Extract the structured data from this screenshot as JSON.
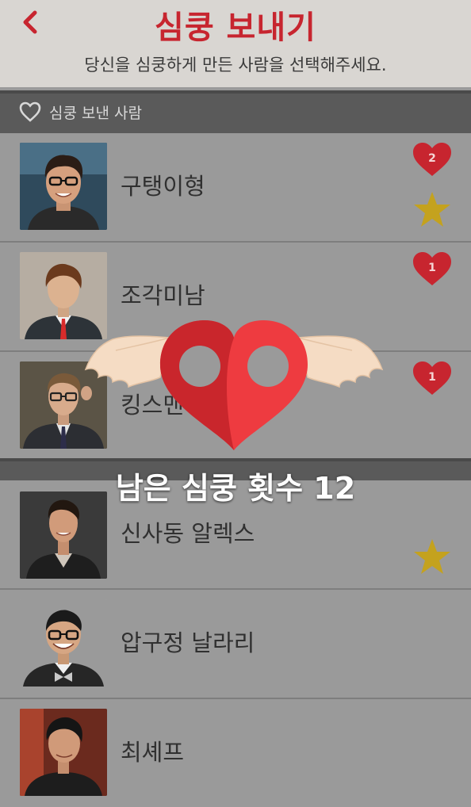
{
  "header": {
    "back_icon": "chevron-left-icon",
    "title": "심쿵 보내기",
    "subtitle": "당신을 심쿵하게 만든 사람을 선택해주세요.",
    "accent_color": "#c7252f"
  },
  "sent_section": {
    "icon": "heart-outline-icon",
    "label": "심쿵 보낸 사람",
    "items": [
      {
        "name": "구탱이형",
        "heart_count": "2",
        "starred": true,
        "avatar": "photo-man-glasses"
      },
      {
        "name": "조각미남",
        "heart_count": "1",
        "starred": false,
        "avatar": "default-avatar"
      },
      {
        "name": "킹스맨",
        "heart_count": "1",
        "starred": false,
        "avatar": "photo-man-suit-glasses"
      }
    ]
  },
  "other_list": {
    "items": [
      {
        "name": "신사동 알렉스",
        "starred": true,
        "avatar": "photo-man-black-shirt"
      },
      {
        "name": "압구정 날라리",
        "starred": false,
        "avatar": "photo-man-bowtie"
      },
      {
        "name": "최셰프",
        "starred": false,
        "avatar": "photo-man-chef"
      }
    ]
  },
  "overlay": {
    "icon": "winged-heart-pin-icon",
    "remaining_text": "남은 심쿵 횟수 12",
    "heart_color": "#ee3b40",
    "star_color": "#c4a21e"
  }
}
